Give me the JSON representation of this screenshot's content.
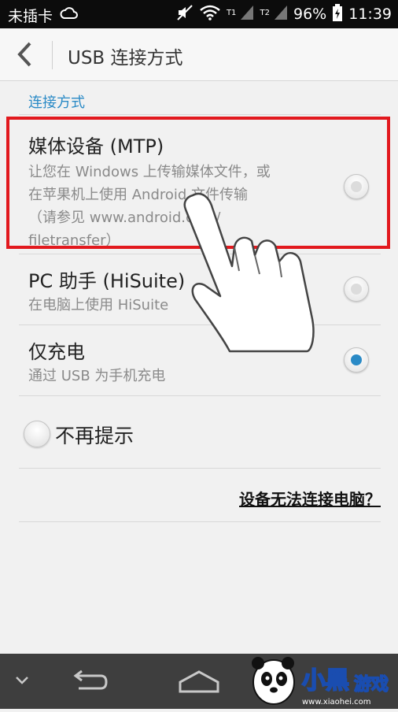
{
  "status_bar": {
    "carrier": "未插卡",
    "sim1": "T1",
    "sim2": "T2",
    "battery": "96%",
    "time": "11:39"
  },
  "action_bar": {
    "title": "USB 连接方式"
  },
  "section_header": "连接方式",
  "options": [
    {
      "title": "媒体设备 (MTP)",
      "desc_lines": [
        "让您在 Windows 上传输媒体文件，或",
        "在苹果机上使用 Android 文件传输",
        "（请参见 www.android.com/",
        "filetransfer）"
      ],
      "selected": false
    },
    {
      "title": "PC 助手 (HiSuite)",
      "desc_lines": [
        "在电脑上使用 HiSuite"
      ],
      "selected": false
    },
    {
      "title": "仅充电",
      "desc_lines": [
        "通过 USB 为手机充电"
      ],
      "selected": true
    }
  ],
  "dont_remind": {
    "label": "不再提示",
    "checked": false
  },
  "help_link": "设备无法连接电脑？",
  "colors": {
    "accent": "#2a8ac6",
    "highlight": "#e2191e",
    "status_bar": "#0c0c0c",
    "nav_bar": "#3e3e3e"
  },
  "watermark": {
    "brand": "小黑游戏",
    "url": "www.xiaohei.com"
  }
}
